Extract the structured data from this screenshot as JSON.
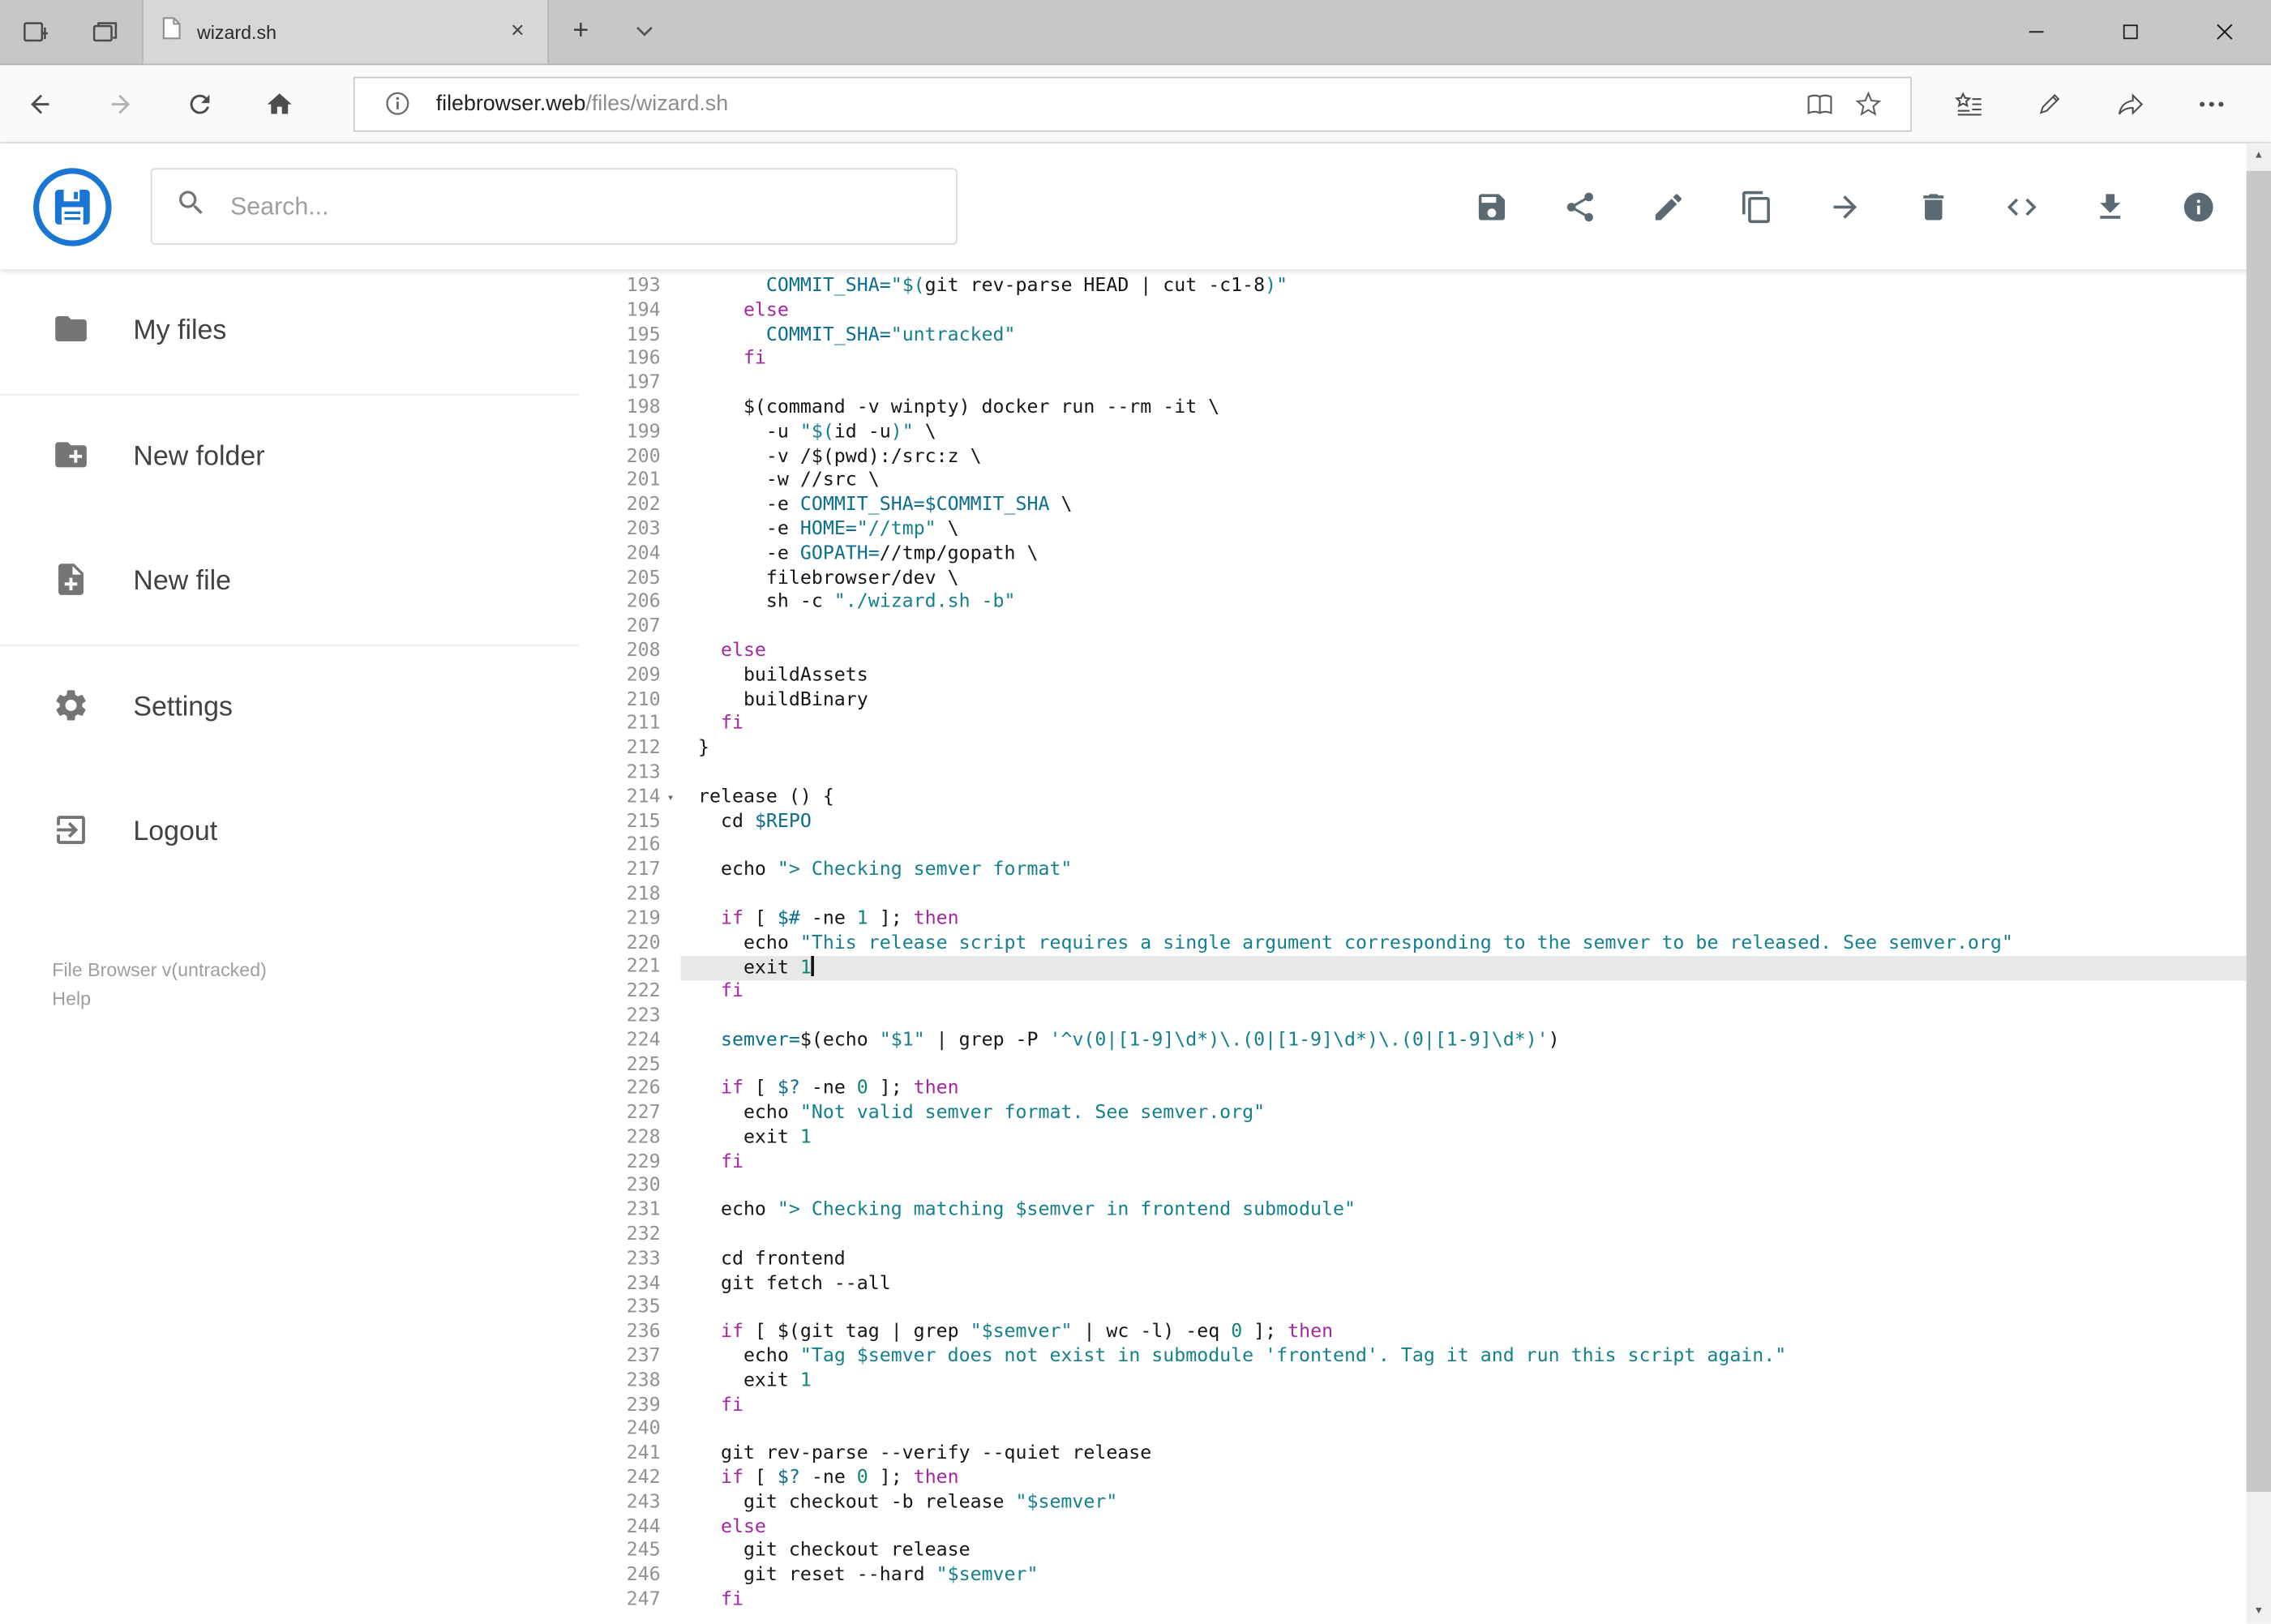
{
  "browser": {
    "tab": {
      "title": "wizard.sh",
      "icons": [
        "page-icon",
        "tab-close-icon"
      ]
    },
    "tabbar_icons": [
      "set-tabs-aside-icon",
      "tab-preview-icon",
      "new-tab-button",
      "tab-preview-chevron"
    ],
    "window_controls": [
      "minimize",
      "maximize",
      "close"
    ],
    "nav_icons": [
      "back-icon",
      "forward-icon",
      "refresh-icon",
      "home-icon"
    ],
    "url": {
      "host": "filebrowser.web",
      "path": "/files/wizard.sh"
    },
    "address_icons": [
      "info-icon",
      "reading-view-icon",
      "favorite-star-icon"
    ],
    "right_icons": [
      "hub-icon",
      "web-note-pen-icon",
      "share-icon",
      "more-icon"
    ]
  },
  "header": {
    "search_placeholder": "Search...",
    "toolbar_icons": [
      "save-icon",
      "share-icon",
      "edit-icon",
      "copy-icon",
      "move-icon",
      "delete-icon",
      "code-icon",
      "download-icon",
      "info-icon"
    ]
  },
  "sidebar": {
    "items": [
      {
        "label": "My files",
        "icon": "folder-icon"
      },
      {
        "label": "New folder",
        "icon": "create-new-folder-icon"
      },
      {
        "label": "New file",
        "icon": "note-add-icon"
      },
      {
        "label": "Settings",
        "icon": "settings-gear-icon"
      },
      {
        "label": "Logout",
        "icon": "logout-icon"
      }
    ],
    "footer": {
      "version": "File Browser v(untracked)",
      "help": "Help"
    }
  },
  "colors": {
    "logo_blue": "#1976d2",
    "keyword": "#a626a4",
    "string": "#15808d",
    "variable": "#0b6e8e",
    "number": "#108577",
    "active_line_bg": "#e8e8e8"
  },
  "editor": {
    "active_line": 221,
    "cursor_line": 221,
    "fold_line": 214,
    "first_line": 193,
    "last_line": 247,
    "lines": [
      {
        "n": 193,
        "tokens": [
          [
            "t",
            "      "
          ],
          [
            "v",
            "COMMIT_SHA="
          ],
          [
            "s",
            "\"$("
          ],
          [
            "t",
            "git rev-parse HEAD | cut -c1-8"
          ],
          [
            "s",
            ")\""
          ]
        ]
      },
      {
        "n": 194,
        "tokens": [
          [
            "t",
            "    "
          ],
          [
            "k",
            "else"
          ]
        ]
      },
      {
        "n": 195,
        "tokens": [
          [
            "t",
            "      "
          ],
          [
            "v",
            "COMMIT_SHA="
          ],
          [
            "s",
            "\"untracked\""
          ]
        ]
      },
      {
        "n": 196,
        "tokens": [
          [
            "t",
            "    "
          ],
          [
            "k",
            "fi"
          ]
        ]
      },
      {
        "n": 197,
        "tokens": []
      },
      {
        "n": 198,
        "tokens": [
          [
            "t",
            "    $(command -v winpty) docker run --rm -it \\"
          ]
        ]
      },
      {
        "n": 199,
        "tokens": [
          [
            "t",
            "      -u "
          ],
          [
            "s",
            "\"$("
          ],
          [
            "t",
            "id -u"
          ],
          [
            "s",
            ")\""
          ],
          [
            "t",
            " \\"
          ]
        ]
      },
      {
        "n": 200,
        "tokens": [
          [
            "t",
            "      -v /$(pwd):/src:z \\"
          ]
        ]
      },
      {
        "n": 201,
        "tokens": [
          [
            "t",
            "      -w //src \\"
          ]
        ]
      },
      {
        "n": 202,
        "tokens": [
          [
            "t",
            "      -e "
          ],
          [
            "v",
            "COMMIT_SHA=$COMMIT_SHA"
          ],
          [
            "t",
            " \\"
          ]
        ]
      },
      {
        "n": 203,
        "tokens": [
          [
            "t",
            "      -e "
          ],
          [
            "v",
            "HOME="
          ],
          [
            "s",
            "\"//tmp\""
          ],
          [
            "t",
            " \\"
          ]
        ]
      },
      {
        "n": 204,
        "tokens": [
          [
            "t",
            "      -e "
          ],
          [
            "v",
            "GOPATH="
          ],
          [
            "t",
            "//tmp/gopath \\"
          ]
        ]
      },
      {
        "n": 205,
        "tokens": [
          [
            "t",
            "      filebrowser/dev \\"
          ]
        ]
      },
      {
        "n": 206,
        "tokens": [
          [
            "t",
            "      sh -c "
          ],
          [
            "s",
            "\"./wizard.sh -b\""
          ]
        ]
      },
      {
        "n": 207,
        "tokens": []
      },
      {
        "n": 208,
        "tokens": [
          [
            "t",
            "  "
          ],
          [
            "k",
            "else"
          ]
        ]
      },
      {
        "n": 209,
        "tokens": [
          [
            "t",
            "    buildAssets"
          ]
        ]
      },
      {
        "n": 210,
        "tokens": [
          [
            "t",
            "    buildBinary"
          ]
        ]
      },
      {
        "n": 211,
        "tokens": [
          [
            "t",
            "  "
          ],
          [
            "k",
            "fi"
          ]
        ]
      },
      {
        "n": 212,
        "tokens": [
          [
            "t",
            "}"
          ]
        ]
      },
      {
        "n": 213,
        "tokens": []
      },
      {
        "n": 214,
        "tokens": [
          [
            "t",
            "release () {"
          ]
        ]
      },
      {
        "n": 215,
        "tokens": [
          [
            "t",
            "  cd "
          ],
          [
            "v",
            "$REPO"
          ]
        ]
      },
      {
        "n": 216,
        "tokens": []
      },
      {
        "n": 217,
        "tokens": [
          [
            "t",
            "  echo "
          ],
          [
            "s",
            "\"> Checking semver format\""
          ]
        ]
      },
      {
        "n": 218,
        "tokens": []
      },
      {
        "n": 219,
        "tokens": [
          [
            "t",
            "  "
          ],
          [
            "k",
            "if"
          ],
          [
            "t",
            " [ "
          ],
          [
            "v",
            "$#"
          ],
          [
            "t",
            " -ne "
          ],
          [
            "n",
            "1"
          ],
          [
            "t",
            " ]; "
          ],
          [
            "k",
            "then"
          ]
        ]
      },
      {
        "n": 220,
        "tokens": [
          [
            "t",
            "    echo "
          ],
          [
            "s",
            "\"This release script requires a single argument corresponding to the semver to be released. See semver.org\""
          ]
        ]
      },
      {
        "n": 221,
        "tokens": [
          [
            "t",
            "    exit "
          ],
          [
            "n",
            "1"
          ]
        ]
      },
      {
        "n": 222,
        "tokens": [
          [
            "t",
            "  "
          ],
          [
            "k",
            "fi"
          ]
        ]
      },
      {
        "n": 223,
        "tokens": []
      },
      {
        "n": 224,
        "tokens": [
          [
            "t",
            "  "
          ],
          [
            "v",
            "semver="
          ],
          [
            "t",
            "$(echo "
          ],
          [
            "s",
            "\"$1\""
          ],
          [
            "t",
            " | grep -P "
          ],
          [
            "s",
            "'^v(0|[1-9]\\d*)\\.(0|[1-9]\\d*)\\.(0|[1-9]\\d*)'"
          ],
          [
            "t",
            ")"
          ]
        ]
      },
      {
        "n": 225,
        "tokens": []
      },
      {
        "n": 226,
        "tokens": [
          [
            "t",
            "  "
          ],
          [
            "k",
            "if"
          ],
          [
            "t",
            " [ "
          ],
          [
            "v",
            "$?"
          ],
          [
            "t",
            " -ne "
          ],
          [
            "n",
            "0"
          ],
          [
            "t",
            " ]; "
          ],
          [
            "k",
            "then"
          ]
        ]
      },
      {
        "n": 227,
        "tokens": [
          [
            "t",
            "    echo "
          ],
          [
            "s",
            "\"Not valid semver format. See semver.org\""
          ]
        ]
      },
      {
        "n": 228,
        "tokens": [
          [
            "t",
            "    exit "
          ],
          [
            "n",
            "1"
          ]
        ]
      },
      {
        "n": 229,
        "tokens": [
          [
            "t",
            "  "
          ],
          [
            "k",
            "fi"
          ]
        ]
      },
      {
        "n": 230,
        "tokens": []
      },
      {
        "n": 231,
        "tokens": [
          [
            "t",
            "  echo "
          ],
          [
            "s",
            "\"> Checking matching $semver in frontend submodule\""
          ]
        ]
      },
      {
        "n": 232,
        "tokens": []
      },
      {
        "n": 233,
        "tokens": [
          [
            "t",
            "  cd frontend"
          ]
        ]
      },
      {
        "n": 234,
        "tokens": [
          [
            "t",
            "  git fetch --all"
          ]
        ]
      },
      {
        "n": 235,
        "tokens": []
      },
      {
        "n": 236,
        "tokens": [
          [
            "t",
            "  "
          ],
          [
            "k",
            "if"
          ],
          [
            "t",
            " [ $(git tag | grep "
          ],
          [
            "s",
            "\"$semver\""
          ],
          [
            "t",
            " | wc -l) -eq "
          ],
          [
            "n",
            "0"
          ],
          [
            "t",
            " ]; "
          ],
          [
            "k",
            "then"
          ]
        ]
      },
      {
        "n": 237,
        "tokens": [
          [
            "t",
            "    echo "
          ],
          [
            "s",
            "\"Tag $semver does not exist in submodule 'frontend'. Tag it and run this script again.\""
          ]
        ]
      },
      {
        "n": 238,
        "tokens": [
          [
            "t",
            "    exit "
          ],
          [
            "n",
            "1"
          ]
        ]
      },
      {
        "n": 239,
        "tokens": [
          [
            "t",
            "  "
          ],
          [
            "k",
            "fi"
          ]
        ]
      },
      {
        "n": 240,
        "tokens": []
      },
      {
        "n": 241,
        "tokens": [
          [
            "t",
            "  git rev-parse --verify --quiet release"
          ]
        ]
      },
      {
        "n": 242,
        "tokens": [
          [
            "t",
            "  "
          ],
          [
            "k",
            "if"
          ],
          [
            "t",
            " [ "
          ],
          [
            "v",
            "$?"
          ],
          [
            "t",
            " -ne "
          ],
          [
            "n",
            "0"
          ],
          [
            "t",
            " ]; "
          ],
          [
            "k",
            "then"
          ]
        ]
      },
      {
        "n": 243,
        "tokens": [
          [
            "t",
            "    git checkout -b release "
          ],
          [
            "s",
            "\"$semver\""
          ]
        ]
      },
      {
        "n": 244,
        "tokens": [
          [
            "t",
            "  "
          ],
          [
            "k",
            "else"
          ]
        ]
      },
      {
        "n": 245,
        "tokens": [
          [
            "t",
            "    git checkout release"
          ]
        ]
      },
      {
        "n": 246,
        "tokens": [
          [
            "t",
            "    git reset --hard "
          ],
          [
            "s",
            "\"$semver\""
          ]
        ]
      },
      {
        "n": 247,
        "tokens": [
          [
            "t",
            "  "
          ],
          [
            "k",
            "fi"
          ]
        ]
      }
    ]
  }
}
